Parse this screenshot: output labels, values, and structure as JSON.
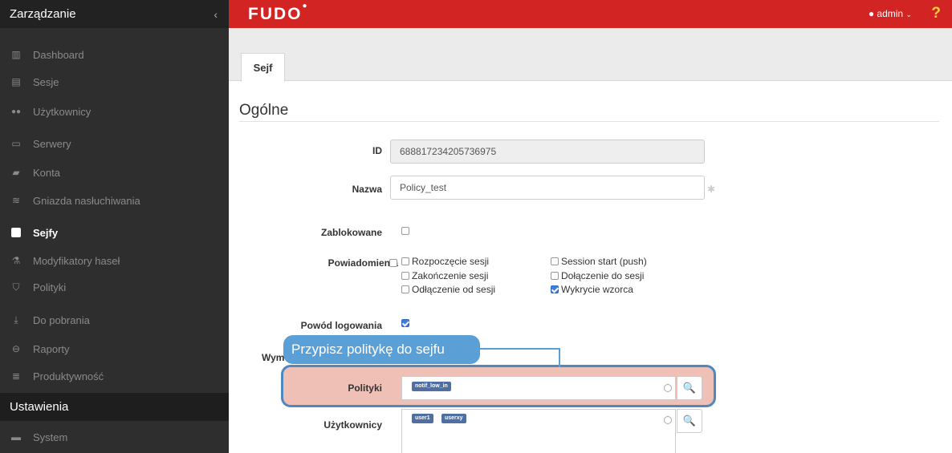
{
  "sidebar": {
    "title": "Zarządzanie",
    "collapse_icon": "‹",
    "items": [
      {
        "label": "Dashboard",
        "icon": "dashboard-icon",
        "glyph": "▥"
      },
      {
        "label": "Sesje",
        "icon": "sessions-icon",
        "glyph": "▤"
      },
      {
        "label": "Użytkownicy",
        "icon": "users-icon",
        "glyph": "👥"
      },
      {
        "label": "Serwery",
        "icon": "servers-icon",
        "glyph": "▭"
      },
      {
        "label": "Konta",
        "icon": "accounts-icon",
        "glyph": "▰"
      },
      {
        "label": "Gniazda nasłuchiwania",
        "icon": "listeners-icon",
        "glyph": "≋"
      },
      {
        "label": "Sejfy",
        "icon": "safes-icon",
        "glyph": "■"
      },
      {
        "label": "Modyfikatory haseł",
        "icon": "password-changers-icon",
        "glyph": "⚗"
      },
      {
        "label": "Polityki",
        "icon": "policies-icon",
        "glyph": "⛉"
      },
      {
        "label": "Do pobrania",
        "icon": "downloads-icon",
        "glyph": "⤓"
      },
      {
        "label": "Raporty",
        "icon": "reports-icon",
        "glyph": "⊖"
      },
      {
        "label": "Produktywność",
        "icon": "productivity-icon",
        "glyph": "≣"
      }
    ],
    "section2": "Ustawienia",
    "settings_items": [
      {
        "label": "System",
        "icon": "folder-icon",
        "glyph": "▬"
      }
    ]
  },
  "topbar": {
    "logo": "FUDO",
    "user": "admin",
    "user_icon": "person-icon",
    "help": "?"
  },
  "tabs": [
    "Sejf"
  ],
  "section": "Ogólne",
  "form": {
    "id_label": "ID",
    "id_value": "688817234205736975",
    "name_label": "Nazwa",
    "name_value": "Policy_test",
    "required_mark": "✱",
    "blocked_label": "Zablokowane",
    "notifications_label": "Powiadomienia",
    "notifications": [
      {
        "label": "Rozpoczęcie sesji",
        "checked": false
      },
      {
        "label": "Zakończenie sesji",
        "checked": false
      },
      {
        "label": "Odłączenie od sesji",
        "checked": false
      },
      {
        "label": "Session start (push)",
        "checked": false
      },
      {
        "label": "Dołączenie do sesji",
        "checked": false
      },
      {
        "label": "Wykrycie wzorca",
        "checked": true
      }
    ],
    "login_reason_label": "Powód logowania",
    "login_reason_checked": true,
    "partial_label": "Wym",
    "policies_label": "Polityki",
    "policies_tags": [
      "notif_low_in"
    ],
    "users_label": "Użytkownicy",
    "users_tags": [
      "user1",
      "userxy"
    ]
  },
  "callout": "Przypisz politykę do sejfu",
  "colors": {
    "brand_red": "#d32424",
    "callout_blue": "#5a9fd6",
    "highlight": "#eec0b6"
  }
}
